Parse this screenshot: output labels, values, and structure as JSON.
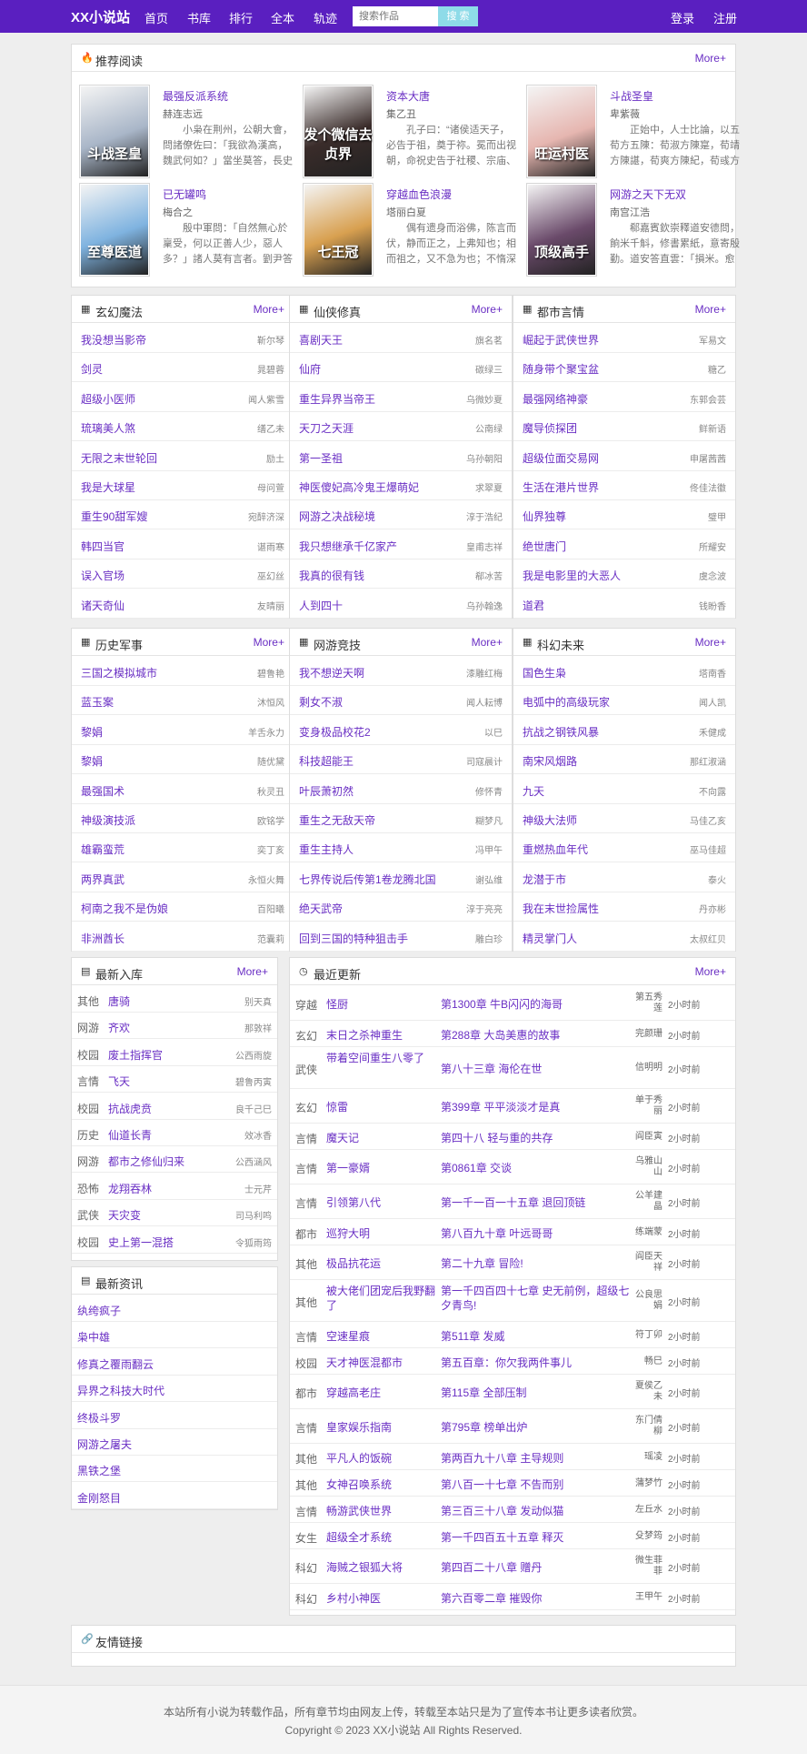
{
  "nav": {
    "logo": "XX小说站",
    "links": [
      "首页",
      "书库",
      "排行",
      "全本",
      "轨迹"
    ],
    "search_placeholder": "搜索作品",
    "search_button": "搜 索",
    "login": "登录",
    "register": "注册"
  },
  "colors": {
    "accent": "#6a2fc4",
    "nav_bg": "#5a1fc0",
    "search_button": "#8edbe8"
  },
  "recommend": {
    "title": "推荐阅读",
    "more": "More+",
    "icon": "fire-icon",
    "items": [
      {
        "title": "最强反派系统",
        "author": "赫连志远",
        "desc": "小枭在荆州，公朝大會，問諸僚佐曰：「我欲為漢高，魏武何如？」當坐莫答，長史江彪曰：",
        "cover_text": "斗战圣皇",
        "cover_color": "#a9b6c8"
      },
      {
        "title": "资本大唐",
        "author": "集乙丑",
        "desc": "孔子曰：“诸侯适天子，必告于祖，奠于祢。冕而出视朝，命祝史告于社稷、宗庙、山川。",
        "cover_text": "发个微信去贞界",
        "cover_color": "#3a2c2a"
      },
      {
        "title": "斗战圣皇",
        "author": "卑紫薇",
        "desc": "正始中，人士比論，以五荀方五陳：荀淑方陳寔，荀靖方陳諶，荀爽方陳紀，荀彧方陳群。",
        "cover_text": "旺运村医",
        "cover_color": "#e6b6b0"
      },
      {
        "title": "已无罐鸣",
        "author": "梅合之",
        "desc": "殷中軍問：「自然無心於稟受，何以正善人少，惡人多？」諸人莫有言者。劉尹答曰：「譬",
        "cover_text": "至尊医道",
        "cover_color": "#7fb3e0"
      },
      {
        "title": "穿越血色浪漫",
        "author": "塔丽白夏",
        "desc": "偶有遗身而浴佛，陈言而伏，静而正之，上弗知也；相而祖之，又不急为也；不惰深",
        "cover_text": "七王冠",
        "cover_color": "#d8a050"
      },
      {
        "title": "网游之天下无双",
        "author": "南宫江浩",
        "desc": "郗嘉賓欽崇釋道安德問，餉米千斛，修書累紙，意寄殷勤。道安答直雲：「損米。愈覺",
        "cover_text": "顶级高手",
        "cover_color": "#6a4a6a"
      }
    ]
  },
  "categories": [
    {
      "title": "玄幻魔法",
      "more": "More+",
      "items": [
        {
          "book": "我没想当影帝",
          "author": "靳尔琴"
        },
        {
          "book": "剑灵",
          "author": "晁碧蓉"
        },
        {
          "book": "超级小医师",
          "author": "闻人紫雪"
        },
        {
          "book": "琉璃美人煞",
          "author": "缮乙未"
        },
        {
          "book": "无限之末世轮回",
          "author": "励土"
        },
        {
          "book": "我是大球星",
          "author": "母问萱"
        },
        {
          "book": "重生90甜军嫂",
          "author": "宛醉济深"
        },
        {
          "book": "韩四当官",
          "author": "谌雨寒"
        },
        {
          "book": "误入官场",
          "author": "巫幻丝"
        },
        {
          "book": "诸天奇仙",
          "author": "友晴丽"
        }
      ]
    },
    {
      "title": "仙侠修真",
      "more": "More+",
      "items": [
        {
          "book": "喜剧天王",
          "author": "旗名茗"
        },
        {
          "book": "仙府",
          "author": "碳绿三"
        },
        {
          "book": "重生异界当帝王",
          "author": "乌微妙夏"
        },
        {
          "book": "天刀之天涯",
          "author": "公南绿"
        },
        {
          "book": "第一圣祖",
          "author": "乌孙朝阳"
        },
        {
          "book": "神医傻妃高冷鬼王爆萌妃",
          "author": "求翠夏"
        },
        {
          "book": "网游之决战秘境",
          "author": "淳于浩纪"
        },
        {
          "book": "我只想继承千亿家产",
          "author": "皇甫志祥"
        },
        {
          "book": "我真的很有钱",
          "author": "郗冰苦"
        },
        {
          "book": "人到四十",
          "author": "乌孙翰逸"
        }
      ]
    },
    {
      "title": "都市言情",
      "more": "More+",
      "items": [
        {
          "book": "崛起于武侠世界",
          "author": "军易文"
        },
        {
          "book": "随身带个聚宝盆",
          "author": "糖乙"
        },
        {
          "book": "最强网络神豪",
          "author": "东郭会芸"
        },
        {
          "book": "魔导侦探团",
          "author": "鲜新语"
        },
        {
          "book": "超级位面交易网",
          "author": "申屠茜茜"
        },
        {
          "book": "生活在港片世界",
          "author": "佟佳法徽"
        },
        {
          "book": "仙界独尊",
          "author": "璧甲"
        },
        {
          "book": "绝世唐门",
          "author": "所耀安"
        },
        {
          "book": "我是电影里的大恶人",
          "author": "虞念波"
        },
        {
          "book": "道君",
          "author": "钱盼香"
        }
      ]
    },
    {
      "title": "历史军事",
      "more": "More+",
      "items": [
        {
          "book": "三国之模拟城市",
          "author": "碧鲁艳"
        },
        {
          "book": "蓝玉案",
          "author": "沐恒风"
        },
        {
          "book": "黎娟",
          "author": "羊舌永力"
        },
        {
          "book": "黎娟",
          "author": "随优黛"
        },
        {
          "book": "最强国术",
          "author": "秋灵丑"
        },
        {
          "book": "神级演技派",
          "author": "欧铭学"
        },
        {
          "book": "雄霸蛮荒",
          "author": "奕丁亥"
        },
        {
          "book": "两界真武",
          "author": "永恒火舞"
        },
        {
          "book": "柯南之我不是伪娘",
          "author": "百阳曦"
        },
        {
          "book": "非洲酋长",
          "author": "范囊莉"
        }
      ]
    },
    {
      "title": "网游竞技",
      "more": "More+",
      "items": [
        {
          "book": "我不想逆天啊",
          "author": "漆雕红梅"
        },
        {
          "book": "剩女不淑",
          "author": "闻人耘博"
        },
        {
          "book": "变身极品校花2",
          "author": "以巳"
        },
        {
          "book": "科技超能王",
          "author": "司寇晨计"
        },
        {
          "book": "叶辰萧初然",
          "author": "修怀青"
        },
        {
          "book": "重生之无敌天帝",
          "author": "糊梦凡"
        },
        {
          "book": "重生主持人",
          "author": "冯甲午"
        },
        {
          "book": "七界传说后传第1卷龙腾北国",
          "author": "谢弘维"
        },
        {
          "book": "绝天武帝",
          "author": "淳于亮亮"
        },
        {
          "book": "回到三国的特种狙击手",
          "author": "雕白珍"
        }
      ]
    },
    {
      "title": "科幻未来",
      "more": "More+",
      "items": [
        {
          "book": "国色生枭",
          "author": "塔南香"
        },
        {
          "book": "电弧中的高级玩家",
          "author": "闻人凯"
        },
        {
          "book": "抗战之钢铁风暴",
          "author": "禾健成"
        },
        {
          "book": "南宋风烟路",
          "author": "那红淑涵"
        },
        {
          "book": "九天",
          "author": "不向露"
        },
        {
          "book": "神级大法师",
          "author": "马佳乙亥"
        },
        {
          "book": "重燃热血年代",
          "author": "巫马佳超"
        },
        {
          "book": "龙潜于市",
          "author": "泰火"
        },
        {
          "book": "我在末世捡属性",
          "author": "丹亦彬"
        },
        {
          "book": "精灵掌门人",
          "author": "太叔红贝"
        }
      ]
    }
  ],
  "new_books": {
    "title": "最新入库",
    "more": "More+",
    "items": [
      {
        "cat": "其他",
        "book": "唐骑",
        "author": "别天真"
      },
      {
        "cat": "网游",
        "book": "齐欢",
        "author": "那敦祥"
      },
      {
        "cat": "校园",
        "book": "废土指挥官",
        "author": "公西雨旋"
      },
      {
        "cat": "言情",
        "book": "飞天",
        "author": "碧鲁丙寅"
      },
      {
        "cat": "校园",
        "book": "抗战虎贲",
        "author": "良千己巳"
      },
      {
        "cat": "历史",
        "book": "仙道长青",
        "author": "效冰香"
      },
      {
        "cat": "网游",
        "book": "都市之修仙归来",
        "author": "公西涵风"
      },
      {
        "cat": "恐怖",
        "book": "龙翔吞林",
        "author": "士元芹"
      },
      {
        "cat": "武侠",
        "book": "天灾变",
        "author": "司马利鸣"
      },
      {
        "cat": "校园",
        "book": "史上第一混搭",
        "author": "令狐雨筠"
      }
    ]
  },
  "news": {
    "title": "最新资讯",
    "items": [
      "纨绔疯子",
      "枭中雄",
      "修真之覆雨翻云",
      "异界之科技大时代",
      "终极斗罗",
      "网游之屠夫",
      "黑铁之堡",
      "金刚怒目"
    ]
  },
  "updates": {
    "title": "最近更新",
    "more": "More+",
    "items": [
      {
        "cat": "穿越",
        "book": "怪厨",
        "chapter": "第1300章 牛B闪闪的海哥",
        "author": "第五秀莲",
        "time": "2小时前"
      },
      {
        "cat": "玄幻",
        "book": "末日之杀神重生",
        "chapter": "第288章 大岛美惠的故事",
        "author": "完颜珊",
        "time": "2小时前"
      },
      {
        "cat": "武侠",
        "book": "带着空间重生八零了",
        "chapter": "第八十三章 海伦在世",
        "author": "信明明",
        "time": "2小时前"
      },
      {
        "cat": "玄幻",
        "book": "惊雷",
        "chapter": "第399章 平平淡淡才是真",
        "author": "单于秀丽",
        "time": "2小时前"
      },
      {
        "cat": "言情",
        "book": "魔天记",
        "chapter": "第四十八 轻与重的共存",
        "author": "阎臣寅",
        "time": "2小时前"
      },
      {
        "cat": "言情",
        "book": "第一豪婿",
        "chapter": "第0861章 交谈",
        "author": "乌雅山山",
        "time": "2小时前"
      },
      {
        "cat": "言情",
        "book": "引领第八代",
        "chapter": "第一千一百一十五章 退回顶链",
        "author": "公羊建晶",
        "time": "2小时前"
      },
      {
        "cat": "都市",
        "book": "巡狩大明",
        "chapter": "第八百九十章 叶远哥哥",
        "author": "练端蒙",
        "time": "2小时前"
      },
      {
        "cat": "其他",
        "book": "极品抗花运",
        "chapter": "第二十九章 冒险!",
        "author": "阎臣天祥",
        "time": "2小时前"
      },
      {
        "cat": "其他",
        "book": "被大佬们团宠后我野翻了",
        "chapter": "第一千四百四十七章 史无前例，超级七夕青鸟!",
        "author": "公良思娟",
        "time": "2小时前"
      },
      {
        "cat": "言情",
        "book": "空速星痕",
        "chapter": "第511章 发威",
        "author": "符丁卯",
        "time": "2小时前"
      },
      {
        "cat": "校园",
        "book": "天才神医混都市",
        "chapter": "第五百章：你欠我两件事儿",
        "author": "畅巳",
        "time": "2小时前"
      },
      {
        "cat": "都市",
        "book": "穿越高老庄",
        "chapter": "第115章 全部压制",
        "author": "夏侯乙未",
        "time": "2小时前"
      },
      {
        "cat": "言情",
        "book": "皇家娱乐指南",
        "chapter": "第795章 榜单出炉",
        "author": "东门倩柳",
        "time": "2小时前"
      },
      {
        "cat": "其他",
        "book": "平凡人的饭碗",
        "chapter": "第两百九十八章 主导规则",
        "author": "瑶凌",
        "time": "2小时前"
      },
      {
        "cat": "其他",
        "book": "女神召唤系统",
        "chapter": "第八百一十七章 不告而别",
        "author": "蒲梦竹",
        "time": "2小时前"
      },
      {
        "cat": "言情",
        "book": "畅游武侠世界",
        "chapter": "第三百三十八章 发动似猫",
        "author": "左丘水",
        "time": "2小时前"
      },
      {
        "cat": "女生",
        "book": "超级全才系统",
        "chapter": "第一千四百五十五章 释灭",
        "author": "殳梦筠",
        "time": "2小时前"
      },
      {
        "cat": "科幻",
        "book": "海贼之银狐大将",
        "chapter": "第四百二十八章 赠丹",
        "author": "微生菲菲",
        "time": "2小时前"
      },
      {
        "cat": "科幻",
        "book": "乡村小神医",
        "chapter": "第六百零二章 摧毁你",
        "author": "王甲午",
        "time": "2小时前"
      }
    ]
  },
  "links": {
    "title": "友情链接"
  },
  "footer": {
    "line1": "本站所有小说为转载作品，所有章节均由网友上传，转载至本站只是为了宣传本书让更多读者欣赏。",
    "line2": "Copyright © 2023 XX小说站 All Rights Reserved."
  }
}
